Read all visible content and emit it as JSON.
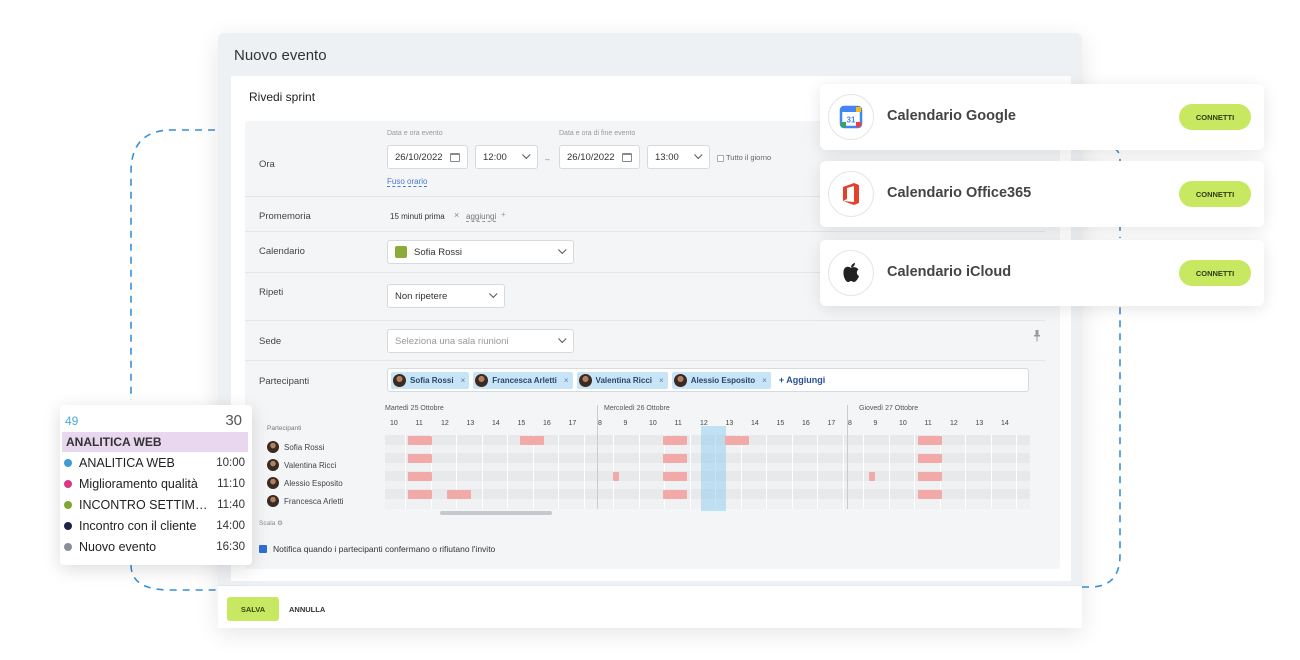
{
  "modal": {
    "title": "Nuovo evento",
    "event_name": "Rivedi sprint",
    "ora": {
      "label": "Ora",
      "start_label": "Data e ora evento",
      "start_date": "26/10/2022",
      "start_time": "12:00",
      "dash": "–",
      "end_label": "Data e ora di fine evento",
      "end_date": "26/10/2022",
      "end_time": "13:00",
      "all_day": "Tutto il giorno",
      "timezone_link": "Fuso orario"
    },
    "promemoria": {
      "label": "Promemoria",
      "value": "15 minuti prima",
      "remove": "×",
      "add": "aggiungi",
      "add_icon": "+"
    },
    "calendario": {
      "label": "Calendario",
      "value": "Sofia Rossi",
      "color": "#8cab3b"
    },
    "ripeti": {
      "label": "Ripeti",
      "value": "Non ripetere"
    },
    "sede": {
      "label": "Sede",
      "placeholder": "Seleziona una sala riunioni"
    },
    "partecipanti": {
      "label": "Partecipanti",
      "chips": [
        "Sofia Rossi",
        "Francesca Arletti",
        "Valentina Ricci",
        "Alessio Esposito"
      ],
      "chip_remove": "×",
      "add": "+ Aggiungi"
    },
    "timeline": {
      "side_label": "Partecipanti",
      "scale_label": "Scala",
      "days": [
        {
          "label": "Martedì 25 Ottobre",
          "hours": [
            "10",
            "11",
            "12",
            "13",
            "14",
            "15",
            "16",
            "17"
          ]
        },
        {
          "label": "Mercoledì 26 Ottobre",
          "hours": [
            "8",
            "9",
            "10",
            "11",
            "12",
            "13",
            "14",
            "15",
            "16",
            "17"
          ]
        },
        {
          "label": "Giovedì 27 Ottobre",
          "hours": [
            "8",
            "9",
            "10",
            "11",
            "12",
            "13",
            "14"
          ]
        }
      ],
      "people": [
        "Sofia Rossi",
        "Valentina Ricci",
        "Alessio Esposito",
        "Francesca Arletti"
      ]
    },
    "notify": "Notifica quando i partecipanti confermano o rifiutano l'invito",
    "save": "SALVA",
    "cancel": "ANNULLA"
  },
  "integrations": [
    {
      "name": "Calendario Google",
      "button": "CONNETTI",
      "icon": "google-calendar-icon"
    },
    {
      "name": "Calendario Office365",
      "button": "CONNETTI",
      "icon": "office365-icon"
    },
    {
      "name": "Calendario iCloud",
      "button": "CONNETTI",
      "icon": "apple-icon"
    }
  ],
  "agenda": {
    "left_number": "49",
    "right_number": "30",
    "header": "ANALITICA WEB",
    "items": [
      {
        "label": "ANALITICA WEB",
        "time": "10:00",
        "color": "#3d9bd6"
      },
      {
        "label": "Miglioramento qualità",
        "time": "11:10",
        "color": "#d63a86"
      },
      {
        "label": "INCONTRO SETTIMANALE",
        "time": "11:40",
        "color": "#7ea832"
      },
      {
        "label": "Incontro con il cliente",
        "time": "14:00",
        "color": "#1c2548"
      },
      {
        "label": "Nuovo evento",
        "time": "16:30",
        "color": "#8a8f96"
      }
    ]
  }
}
